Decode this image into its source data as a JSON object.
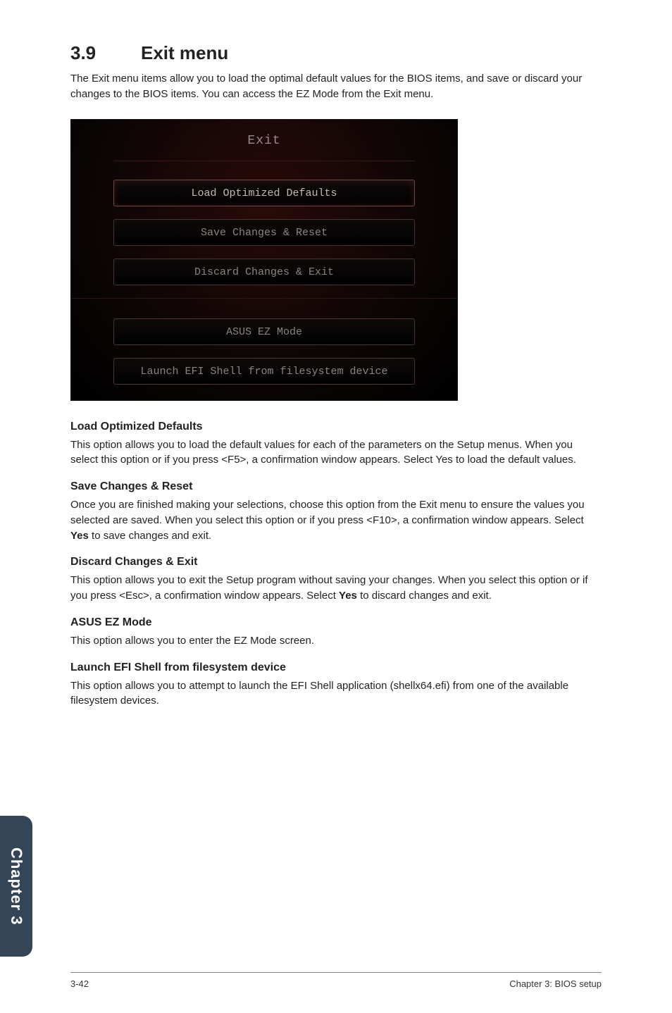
{
  "section": {
    "number": "3.9",
    "title": "Exit menu"
  },
  "intro": "The Exit menu items allow you to load the optimal default values for the BIOS items, and save or discard your changes to the BIOS items. You can access the EZ Mode from the Exit menu.",
  "bios": {
    "title": "Exit",
    "buttons": {
      "load_defaults": "Load Optimized Defaults",
      "save_reset": "Save Changes & Reset",
      "discard_exit": "Discard Changes & Exit",
      "ez_mode": "ASUS EZ Mode",
      "launch_efi": "Launch EFI Shell from filesystem device"
    }
  },
  "subsections": {
    "load_defaults": {
      "heading": "Load Optimized Defaults",
      "body": "This option allows you to load the default values for each of the parameters on the Setup menus. When you select this option or if you press <F5>, a confirmation window appears. Select Yes to load the default values."
    },
    "save_reset": {
      "heading": "Save Changes & Reset",
      "body_a": "Once you are finished making your selections, choose this option from the Exit menu to ensure the values you selected are saved. When you select this option or if you press <F10>, a confirmation window appears. Select ",
      "body_yes": "Yes",
      "body_b": " to save changes and exit."
    },
    "discard_exit": {
      "heading": "Discard Changes & Exit",
      "body_a": "This option allows you to exit the Setup program without saving your changes. When you select this option or if you press <Esc>, a confirmation window appears. Select ",
      "body_yes": "Yes",
      "body_b": " to discard changes and exit."
    },
    "ez_mode": {
      "heading": "ASUS EZ Mode",
      "body": "This option allows you to enter the EZ Mode screen."
    },
    "launch_efi": {
      "heading": "Launch EFI Shell from filesystem device",
      "body": "This option allows you to attempt to launch the EFI Shell application (shellx64.efi) from one of the available filesystem devices."
    }
  },
  "sidetab": "Chapter 3",
  "footer": {
    "page": "3-42",
    "chapter": "Chapter 3: BIOS setup"
  }
}
